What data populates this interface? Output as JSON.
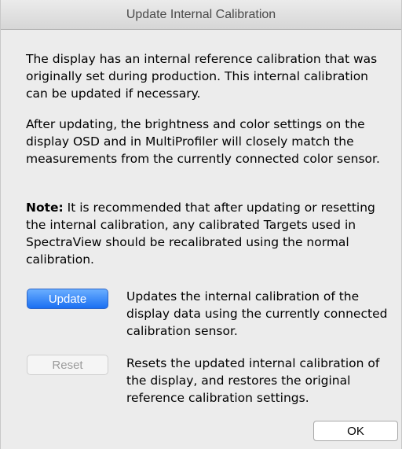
{
  "window": {
    "title": "Update Internal Calibration"
  },
  "body": {
    "paragraph1": "The display has an internal reference calibration that was originally set during production. This internal calibration can be updated if necessary.",
    "paragraph2": "After updating, the brightness and color settings on the display OSD and in MultiProfiler will closely match the measurements from the currently connected color sensor.",
    "note_label": "Note:",
    "note_text": " It is recommended that after updating or resetting the internal calibration, any calibrated Targets used in SpectraView should be recalibrated using the normal calibration."
  },
  "actions": {
    "update": {
      "label": "Update",
      "description": "Updates the internal calibration of the display data using the currently connected calibration sensor."
    },
    "reset": {
      "label": "Reset",
      "description": "Resets the updated internal calibration of the display, and restores the original reference calibration settings."
    },
    "ok_label": "OK"
  },
  "colors": {
    "update_button": "#1a6ff2",
    "window_background": "#ececec"
  }
}
